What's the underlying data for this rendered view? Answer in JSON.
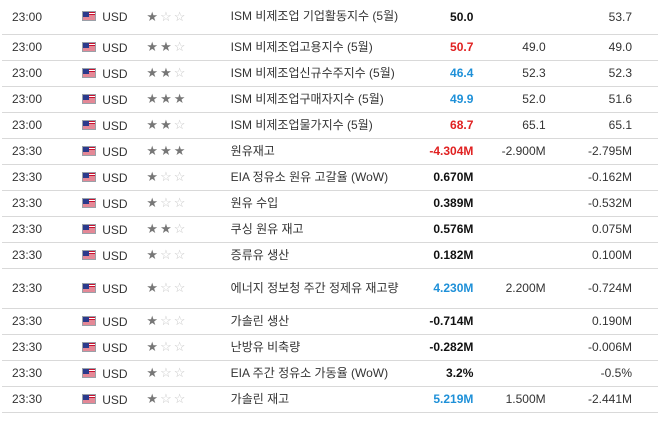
{
  "rows": [
    {
      "time": "23:00",
      "currency": "USD",
      "stars": 1,
      "event": "ISM 비제조업 기업활동지수 (5월)",
      "actual": "50.0",
      "actual_color": "black",
      "forecast": "",
      "previous": "53.7"
    },
    {
      "time": "23:00",
      "currency": "USD",
      "stars": 2,
      "event": "ISM 비제조업고용지수 (5월)",
      "actual": "50.7",
      "actual_color": "red",
      "forecast": "49.0",
      "previous": "49.0"
    },
    {
      "time": "23:00",
      "currency": "USD",
      "stars": 2,
      "event": "ISM 비제조업신규수주지수 (5월)",
      "actual": "46.4",
      "actual_color": "blue",
      "forecast": "52.3",
      "previous": "52.3"
    },
    {
      "time": "23:00",
      "currency": "USD",
      "stars": 3,
      "event": "ISM 비제조업구매자지수 (5월)",
      "actual": "49.9",
      "actual_color": "blue",
      "forecast": "52.0",
      "previous": "51.6"
    },
    {
      "time": "23:00",
      "currency": "USD",
      "stars": 2,
      "event": "ISM 비제조업물가지수 (5월)",
      "actual": "68.7",
      "actual_color": "red",
      "forecast": "65.1",
      "previous": "65.1"
    },
    {
      "time": "23:30",
      "currency": "USD",
      "stars": 3,
      "event": "원유재고",
      "actual": "-4.304M",
      "actual_color": "red",
      "forecast": "-2.900M",
      "previous": "-2.795M"
    },
    {
      "time": "23:30",
      "currency": "USD",
      "stars": 1,
      "event": "EIA 정유소 원유 고갈율 (WoW)",
      "actual": "0.670M",
      "actual_color": "black",
      "forecast": "",
      "previous": "-0.162M"
    },
    {
      "time": "23:30",
      "currency": "USD",
      "stars": 1,
      "event": "원유 수입",
      "actual": "0.389M",
      "actual_color": "black",
      "forecast": "",
      "previous": "-0.532M"
    },
    {
      "time": "23:30",
      "currency": "USD",
      "stars": 2,
      "event": "쿠싱 원유 재고",
      "actual": "0.576M",
      "actual_color": "black",
      "forecast": "",
      "previous": "0.075M"
    },
    {
      "time": "23:30",
      "currency": "USD",
      "stars": 1,
      "event": "증류유 생산",
      "actual": "0.182M",
      "actual_color": "black",
      "forecast": "",
      "previous": "0.100M"
    },
    {
      "time": "23:30",
      "currency": "USD",
      "stars": 1,
      "event": "에너지 정보청 주간 정제유 재고량",
      "actual": "4.230M",
      "actual_color": "blue",
      "forecast": "2.200M",
      "previous": "-0.724M"
    },
    {
      "time": "23:30",
      "currency": "USD",
      "stars": 1,
      "event": "가솔린 생산",
      "actual": "-0.714M",
      "actual_color": "black",
      "forecast": "",
      "previous": "0.190M"
    },
    {
      "time": "23:30",
      "currency": "USD",
      "stars": 1,
      "event": "난방유 비축량",
      "actual": "-0.282M",
      "actual_color": "black",
      "forecast": "",
      "previous": "-0.006M"
    },
    {
      "time": "23:30",
      "currency": "USD",
      "stars": 1,
      "event": "EIA 주간 정유소 가동율 (WoW)",
      "actual": "3.2%",
      "actual_color": "black",
      "forecast": "",
      "previous": "-0.5%"
    },
    {
      "time": "23:30",
      "currency": "USD",
      "stars": 1,
      "event": "가솔린 재고",
      "actual": "5.219M",
      "actual_color": "blue",
      "forecast": "1.500M",
      "previous": "-2.441M"
    }
  ],
  "icons": {
    "flag": "us-flag-icon",
    "star_filled": "star-filled-icon",
    "star_empty": "star-empty-icon"
  },
  "colors": {
    "red": "#e02020",
    "blue": "#1e90d8",
    "black": "#111111",
    "star_on": "#777777",
    "star_off": "#c8c8c8",
    "row_border": "#d9d9d9"
  }
}
